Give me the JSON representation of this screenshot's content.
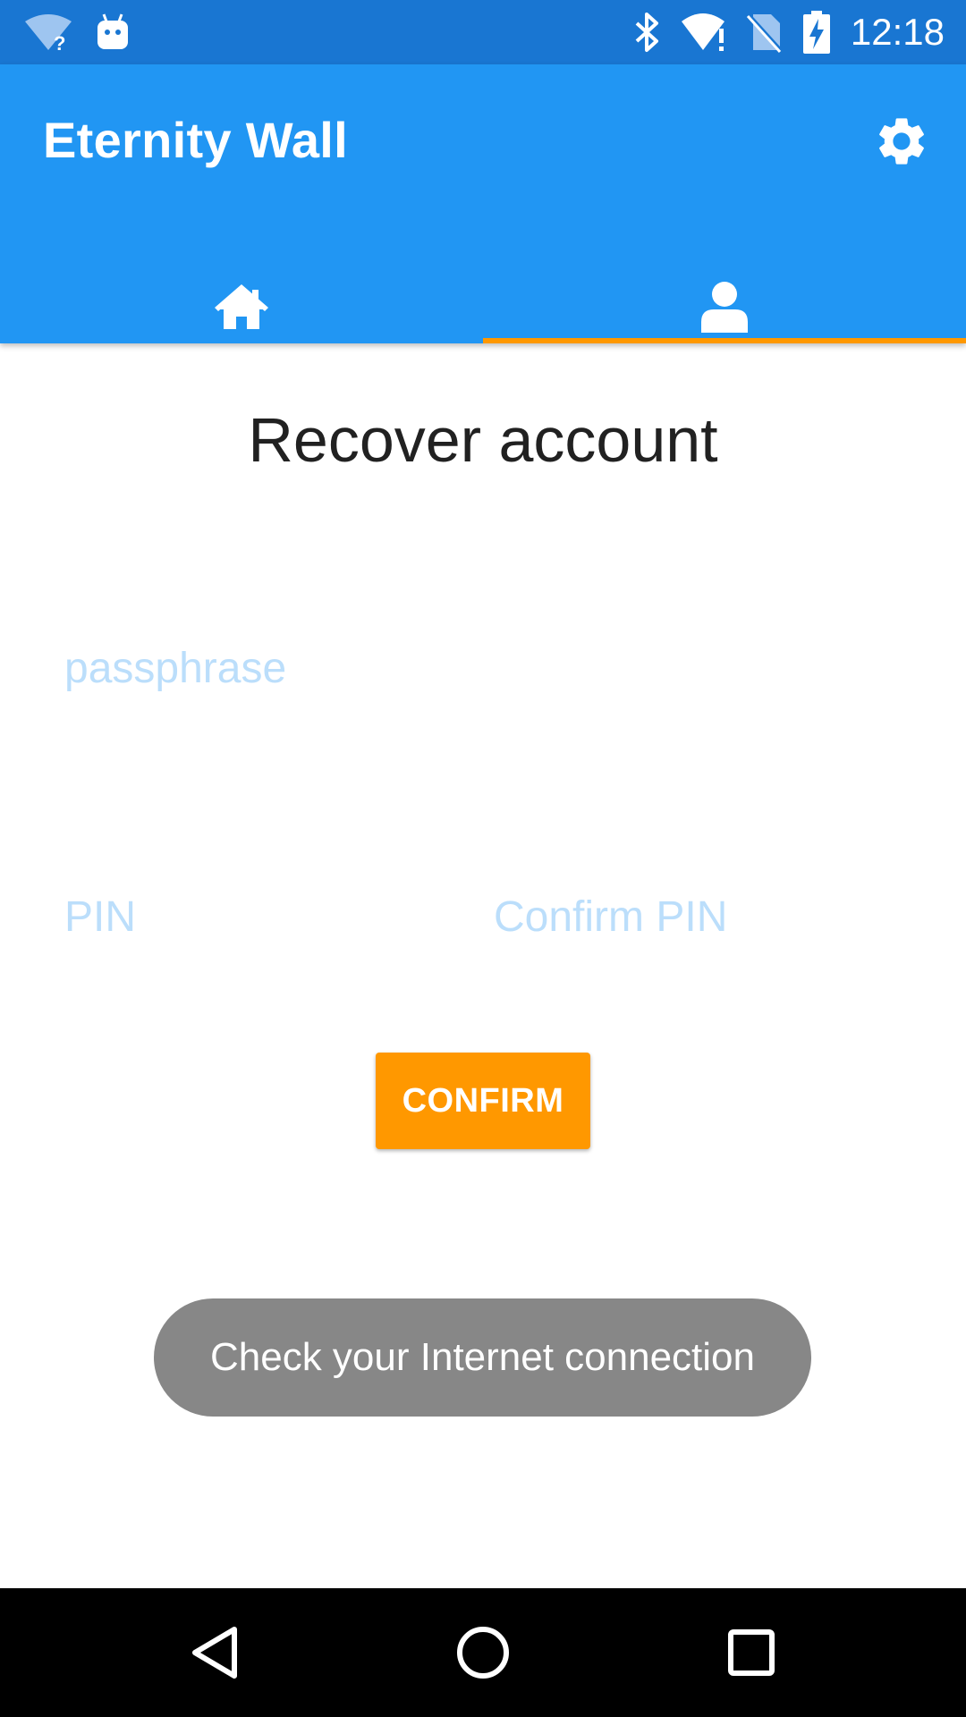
{
  "status_bar": {
    "time": "12:18",
    "icons": [
      "wifi-unknown-icon",
      "android-debug-icon",
      "bluetooth-icon",
      "wifi-alert-icon",
      "no-sim-icon",
      "battery-charging-icon"
    ]
  },
  "app_bar": {
    "title": "Eternity Wall",
    "settings_icon": "gear-icon"
  },
  "tabs": [
    {
      "icon": "home-icon",
      "selected": false
    },
    {
      "icon": "person-icon",
      "selected": true
    }
  ],
  "colors": {
    "status_bar": "#1976D2",
    "app_bar": "#2196F3",
    "accent": "#FF9800",
    "hint": "#BBDEFB",
    "toast": "#878787"
  },
  "main": {
    "title": "Recover account",
    "passphrase_placeholder": "passphrase",
    "pin_placeholder": "PIN",
    "confirm_pin_placeholder": "Confirm PIN",
    "confirm_label": "CONFIRM"
  },
  "toast": {
    "message": "Check your Internet connection"
  },
  "nav_bar": {
    "icons": [
      "back-icon",
      "home-circle-icon",
      "recents-icon"
    ]
  }
}
